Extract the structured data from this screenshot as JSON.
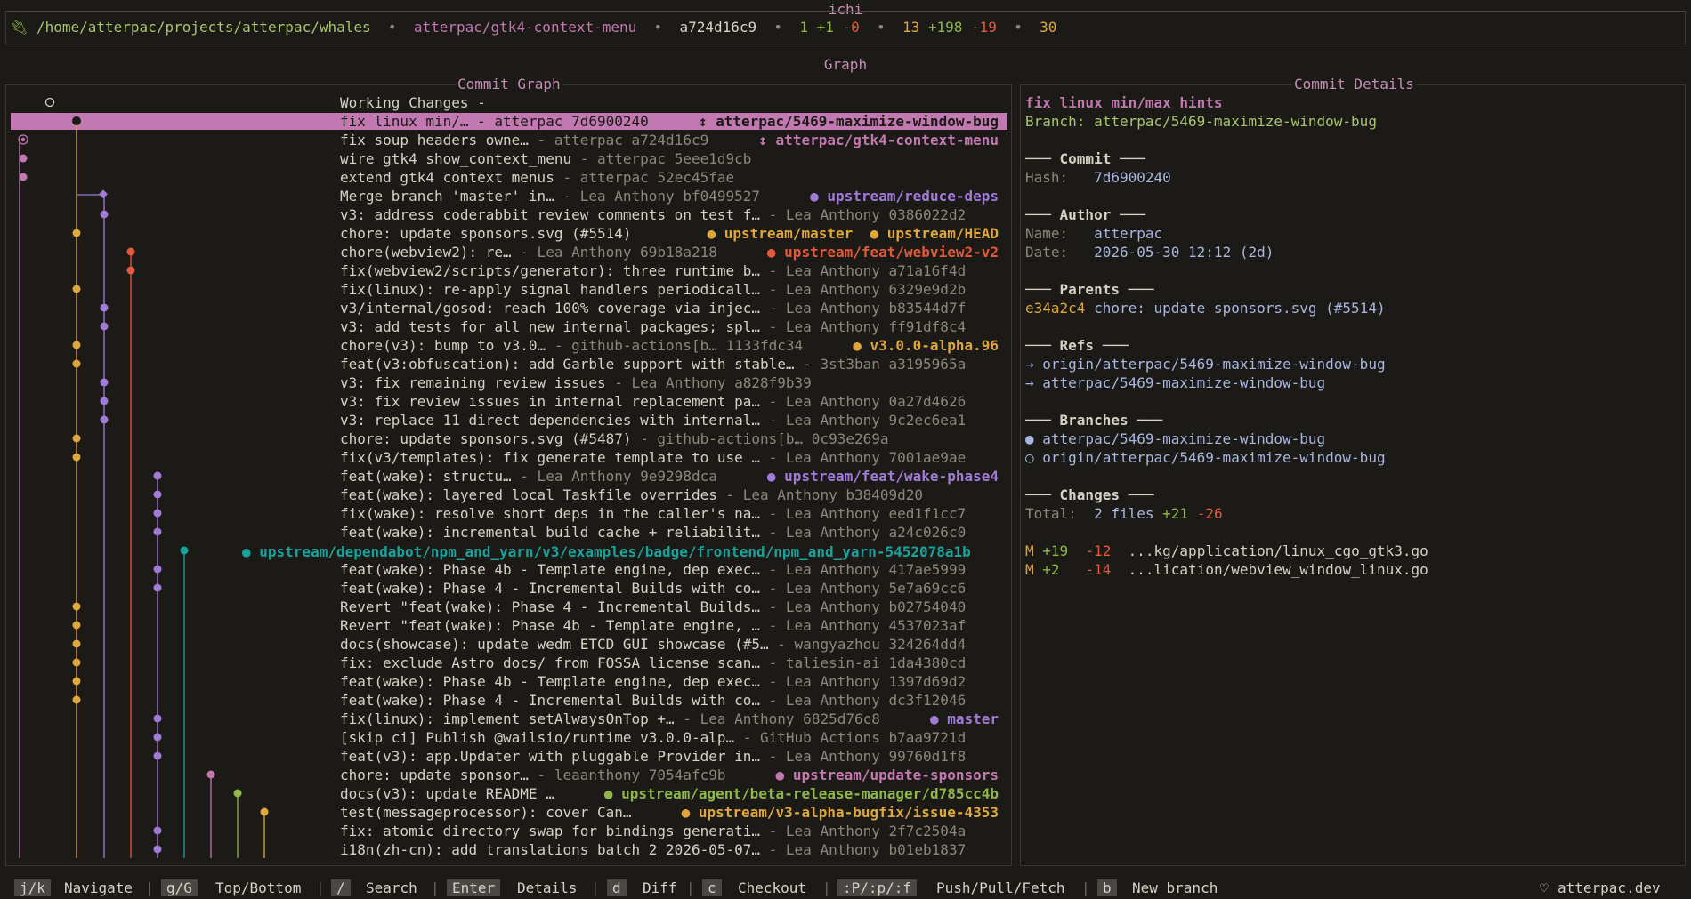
{
  "app": {
    "title": "ichi"
  },
  "status": {
    "icon": "plug-icon",
    "path": "/home/atterpac/projects/atterpac/whales",
    "sep": "•",
    "branch": "atterpac/gtk4-context-menu",
    "hash": "a724d16c9",
    "commits": "1",
    "ahead": "+1",
    "behind": "-0",
    "files": "13",
    "added": "+198",
    "removed": "-19",
    "stash": "30"
  },
  "graph_title": "Graph",
  "commit_graph": {
    "title": "Commit Graph",
    "rows": [
      {
        "msg": "Working Changes -",
        "author": "",
        "hash": "",
        "ref": "",
        "ref_color": ""
      },
      {
        "msg": "fix linux min/… - atterpac 7d6900240",
        "ref": "↕ atterpac/5469-maximize-window-bug",
        "ref_color": "#1b1a16"
      },
      {
        "msg": "fix soup headers owne…",
        "meta": " - atterpac a724d16c9",
        "ref": "↕ atterpac/gtk4-context-menu",
        "ref_color": "#c278b0"
      },
      {
        "msg": "wire gtk4 show_context_menu",
        "meta": " - atterpac 5eee1d9cb",
        "ref": "",
        "ref_color": ""
      },
      {
        "msg": "extend gtk4 context menus",
        "meta": " - atterpac 52ec45fae",
        "ref": "",
        "ref_color": ""
      },
      {
        "msg": "Merge branch 'master' in…",
        "meta": " - Lea Anthony bf0499527",
        "ref": "● upstream/reduce-deps",
        "ref_color": "#a27ad8"
      },
      {
        "msg": "v3: address coderabbit review comments on test f…",
        "meta": " - Lea Anthony 0386022d2",
        "ref": "",
        "ref_color": ""
      },
      {
        "msg": "chore: update sponsors.svg (#5514)",
        "meta": "",
        "ref": "● upstream/master  ● upstream/HEAD",
        "ref_color": "#e0a63e"
      },
      {
        "msg": "chore(webview2): re…",
        "meta": " - Lea Anthony 69b18a218",
        "ref": "● upstream/feat/webview2-v2",
        "ref_color": "#e25a3c"
      },
      {
        "msg": "fix(webview2/scripts/generator): three runtime b…",
        "meta": " - Lea Anthony a71a16f4d",
        "ref": "",
        "ref_color": ""
      },
      {
        "msg": "fix(linux): re-apply signal handlers periodicall…",
        "meta": " - Lea Anthony 6329e9d2b",
        "ref": "",
        "ref_color": ""
      },
      {
        "msg": "v3/internal/gosod: reach 100% coverage via injec…",
        "meta": " - Lea Anthony b83544d7f",
        "ref": "",
        "ref_color": ""
      },
      {
        "msg": "v3: add tests for all new internal packages; spl…",
        "meta": " - Lea Anthony ff91df8c4",
        "ref": "",
        "ref_color": ""
      },
      {
        "msg": "chore(v3): bump to v3.0…",
        "meta": " - github-actions[b… 1133fdc34",
        "ref": "● v3.0.0-alpha.96",
        "ref_color": "#e0a63e"
      },
      {
        "msg": "feat(v3:obfuscation): add Garble support with stable…",
        "meta": " - 3st3ban a3195965a",
        "ref": "",
        "ref_color": ""
      },
      {
        "msg": "v3: fix remaining review issues",
        "meta": " - Lea Anthony a828f9b39",
        "ref": "",
        "ref_color": ""
      },
      {
        "msg": "v3: fix review issues in internal replacement pa…",
        "meta": " - Lea Anthony 0a27d4626",
        "ref": "",
        "ref_color": ""
      },
      {
        "msg": "v3: replace 11 direct dependencies with internal…",
        "meta": " - Lea Anthony 9c2ec6ea1",
        "ref": "",
        "ref_color": ""
      },
      {
        "msg": "chore: update sponsors.svg (#5487)",
        "meta": " - github-actions[b… 0c93e269a",
        "ref": "",
        "ref_color": ""
      },
      {
        "msg": "fix(v3/templates): fix generate template to use …",
        "meta": " - Lea Anthony 7001ae9ae",
        "ref": "",
        "ref_color": ""
      },
      {
        "msg": "feat(wake): structu…",
        "meta": " - Lea Anthony 9e9298dca",
        "ref": "● upstream/feat/wake-phase4",
        "ref_color": "#a27ad8"
      },
      {
        "msg": "feat(wake): layered local Taskfile overrides",
        "meta": " - Lea Anthony b38409d20",
        "ref": "",
        "ref_color": ""
      },
      {
        "msg": "fix(wake): resolve short deps in the caller's na…",
        "meta": " - Lea Anthony eed1f1cc7",
        "ref": "",
        "ref_color": ""
      },
      {
        "msg": "feat(wake): incremental build cache + reliabilit…",
        "meta": " - Lea Anthony a24c026c0",
        "ref": "",
        "ref_color": ""
      },
      {
        "msg": "",
        "meta": "",
        "ref": "",
        "ref_color": ""
      },
      {
        "msg": "feat(wake): Phase 4b - Template engine, dep exec…",
        "meta": " - Lea Anthony 417ae5999",
        "ref": "",
        "ref_color": ""
      },
      {
        "msg": "feat(wake): Phase 4 - Incremental Builds with co…",
        "meta": " - Lea Anthony 5e7a69cc6",
        "ref": "",
        "ref_color": ""
      },
      {
        "msg": "Revert \"feat(wake): Phase 4 - Incremental Builds…",
        "meta": " - Lea Anthony b02754040",
        "ref": "",
        "ref_color": ""
      },
      {
        "msg": "Revert \"feat(wake): Phase 4b - Template engine, …",
        "meta": " - Lea Anthony 4537023af",
        "ref": "",
        "ref_color": ""
      },
      {
        "msg": "docs(showcase): update wedm ETCD GUI showcase (#5…",
        "meta": " - wangyazhou 324264dd4",
        "ref": "",
        "ref_color": ""
      },
      {
        "msg": "fix: exclude Astro docs/ from FOSSA license scan…",
        "meta": " - taliesin-ai 1da4380cd",
        "ref": "",
        "ref_color": ""
      },
      {
        "msg": "feat(wake): Phase 4b - Template engine, dep exec…",
        "meta": " - Lea Anthony 1397d69d2",
        "ref": "",
        "ref_color": ""
      },
      {
        "msg": "feat(wake): Phase 4 - Incremental Builds with co…",
        "meta": " - Lea Anthony dc3f12046",
        "ref": "",
        "ref_color": ""
      },
      {
        "msg": "fix(linux): implement setAlwaysOnTop +…",
        "meta": " - Lea Anthony 6825d76c8",
        "ref": "● master",
        "ref_color": "#a27ad8"
      },
      {
        "msg": "[skip ci] Publish @wailsio/runtime v3.0.0-alp…",
        "meta": " - GitHub Actions b7aa9721d",
        "ref": "",
        "ref_color": ""
      },
      {
        "msg": "feat(v3): app.Updater with pluggable Provider in…",
        "meta": " - Lea Anthony 99760d1f8",
        "ref": "",
        "ref_color": ""
      },
      {
        "msg": "chore: update sponsor…",
        "meta": " - leaanthony 7054afc9b",
        "ref": "● upstream/update-sponsors",
        "ref_color": "#c278b0"
      },
      {
        "msg": "docs(v3): update README …",
        "meta": "",
        "ref": "● upstream/agent/beta-release-manager/d785cc4b",
        "ref_color": "#8fb84a"
      },
      {
        "msg": "test(messageprocessor): cover Can…",
        "meta": "",
        "ref": "● upstream/v3-alpha-bugfix/issue-4353",
        "ref_color": "#e0a63e"
      },
      {
        "msg": "fix: atomic directory swap for bindings generati…",
        "meta": " - Lea Anthony 2f7c2504a",
        "ref": "",
        "ref_color": ""
      },
      {
        "msg": "i18n(zh-cn): add translations batch 2 2026-05-07…",
        "meta": " - Lea Anthony b01eb1837",
        "ref": "",
        "ref_color": ""
      }
    ],
    "dependabot_ref": "● upstream/dependabot/npm_and_yarn/v3/examples/badge/frontend/npm_and_yarn-5452078a1b"
  },
  "commit_details": {
    "title": "Commit Details",
    "subject": "fix linux min/max hints",
    "branch_line": "Branch: atterpac/5469-maximize-window-bug",
    "commit_header": "─── Commit ───",
    "hash_label": "Hash:",
    "hash": "7d6900240",
    "author_header": "─── Author ───",
    "name_label": "Name:",
    "name": "atterpac",
    "date_label": "Date:",
    "date": "2026-05-30 12:12 (2d)",
    "parents_header": "─── Parents ───",
    "parent_hash": "e34a2c4",
    "parent_msg": " chore: update sponsors.svg (#5514)",
    "refs_header": "─── Refs ───",
    "refs": [
      "→ origin/atterpac/5469-maximize-window-bug",
      "→ atterpac/5469-maximize-window-bug"
    ],
    "branches_header": "─── Branches ───",
    "branch_local": "● atterpac/5469-maximize-window-bug",
    "branch_remote": "○ origin/atterpac/5469-maximize-window-bug",
    "changes_header": "─── Changes ───",
    "total_label": "Total:",
    "total_files": "2 files",
    "total_add": "+21",
    "total_del": "-26",
    "files": [
      {
        "status": "M",
        "add": "+19",
        "del": "-12",
        "path": "...kg/application/linux_cgo_gtk3.go"
      },
      {
        "status": "M",
        "add": "+2",
        "del": "-14",
        "path": "...lication/webview_window_linux.go"
      }
    ]
  },
  "hints": [
    {
      "key": "j/k",
      "label": "Navigate"
    },
    {
      "key": "g/G",
      "label": "Top/Bottom"
    },
    {
      "key": "/",
      "label": "Search"
    },
    {
      "key": "Enter",
      "label": "Details"
    },
    {
      "key": "d",
      "label": "Diff"
    },
    {
      "key": "c",
      "label": "Checkout"
    },
    {
      "key": ":P/:p/:f",
      "label": "Push/Pull/Fetch"
    },
    {
      "key": "b",
      "label": "New branch"
    }
  ],
  "footer": {
    "heart_icon": "heart-icon",
    "site": "atterpac.dev"
  },
  "colors": {
    "accent": "#c278b0",
    "pink": "#c278b0",
    "purple": "#a27ad8",
    "orange": "#e0a63e",
    "red": "#e25a3c",
    "teal": "#1aa39c",
    "green": "#8fb84a",
    "muted": "#8c877b"
  }
}
